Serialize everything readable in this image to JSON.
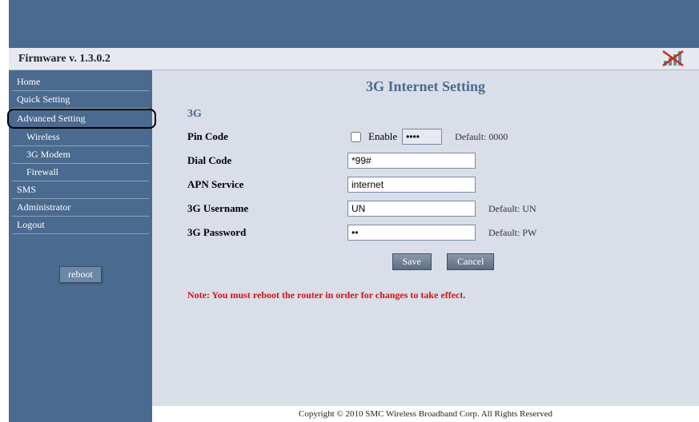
{
  "firmware_label": "Firmware v.  1.3.0.2",
  "sidebar": {
    "items": [
      {
        "label": "Home"
      },
      {
        "label": "Quick Setting"
      },
      {
        "label": "Advanced Setting",
        "highlight": true
      },
      {
        "label": "Wireless",
        "sub": true
      },
      {
        "label": "3G Modem",
        "sub": true
      },
      {
        "label": "Firewall",
        "sub": true
      },
      {
        "label": "SMS"
      },
      {
        "label": "Administrator"
      },
      {
        "label": "Logout"
      }
    ],
    "reboot_label": "reboot"
  },
  "page": {
    "title": "3G Internet Setting",
    "section": "3G",
    "fields": {
      "pin": {
        "label": "Pin Code",
        "enable_label": "Enable",
        "value": "••••",
        "hint": "Default: 0000",
        "checked": false
      },
      "dial": {
        "label": "Dial Code",
        "value": "*99#"
      },
      "apn": {
        "label": "APN Service",
        "value": "internet"
      },
      "user": {
        "label": "3G Username",
        "value": "UN",
        "hint": "Default: UN"
      },
      "pass": {
        "label": "3G Password",
        "value": "••",
        "hint": "Default: PW"
      }
    },
    "buttons": {
      "save": "Save",
      "cancel": "Cancel"
    },
    "note": "Note: You must reboot the router in order for changes to take effect."
  },
  "footer": "Copyright © 2010 SMC Wireless Broadband Corp. All Rights Reserved"
}
